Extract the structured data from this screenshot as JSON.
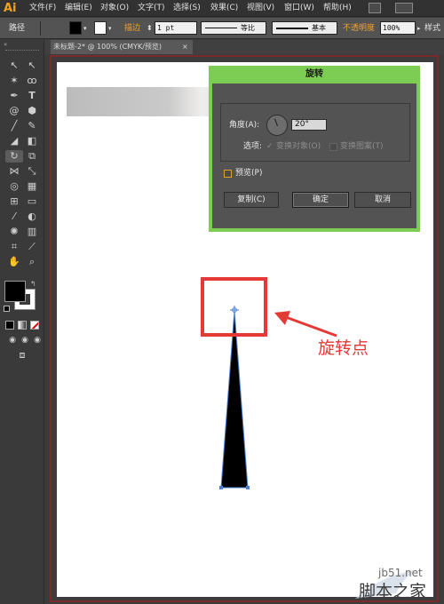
{
  "app": {
    "logo": "Ai"
  },
  "menu": [
    "文件(F)",
    "编辑(E)",
    "对象(O)",
    "文字(T)",
    "选择(S)",
    "效果(C)",
    "视图(V)",
    "窗口(W)",
    "帮助(H)"
  ],
  "control_bar": {
    "object_type": "路径",
    "stroke_label": "描边",
    "stroke_weight": "1 pt",
    "stroke_profile": "等比",
    "brush": "基本",
    "opacity_label": "不透明度",
    "opacity_value": "100%",
    "style_label": "样式"
  },
  "document_tab": {
    "title": "未标题-2* @ 100% (CMYK/预览)",
    "close": "×"
  },
  "rotate_dialog": {
    "title": "旋转",
    "angle_label": "角度(A):",
    "angle_value": "20°",
    "options_label": "选项:",
    "transform_objects": "变换对象(O)",
    "transform_patterns": "变换图案(T)",
    "preview": "预览(P)",
    "copy_button": "复制(C)",
    "ok_button": "确定",
    "cancel_button": "取消"
  },
  "annotation": {
    "label": "旋转点"
  },
  "watermark": {
    "line1": "jb51.net",
    "line2": "脚本之家"
  },
  "colors": {
    "dialog_accent": "#7dcc53",
    "annotation_red": "#e53935",
    "anchor_blue": "#4a7fd4"
  }
}
